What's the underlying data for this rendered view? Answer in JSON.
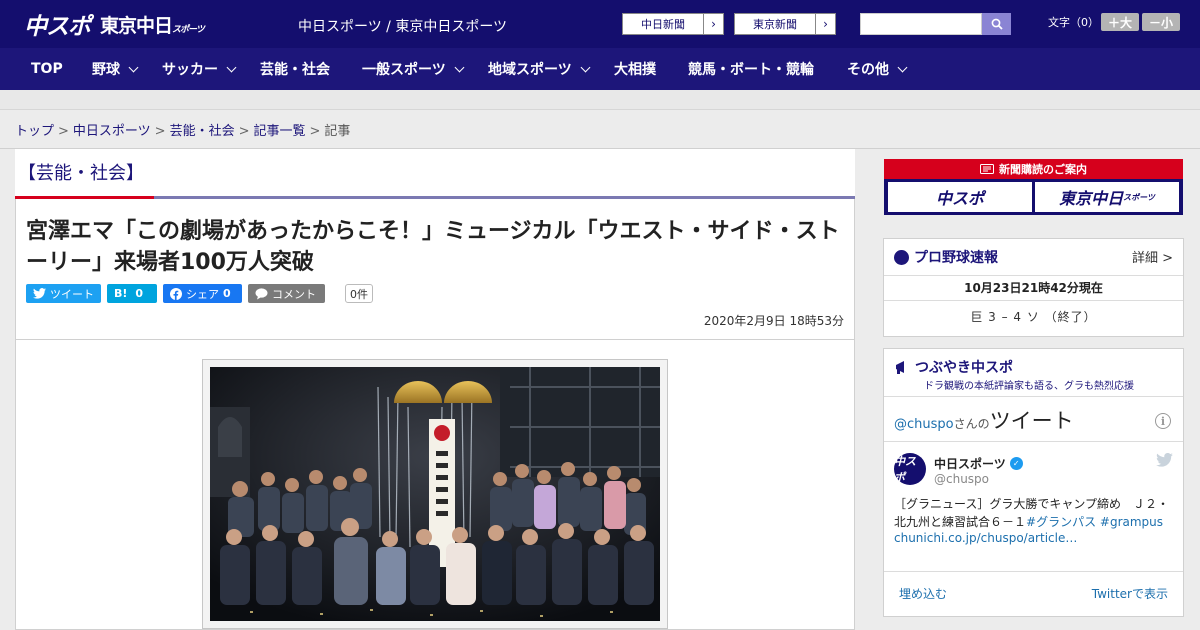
{
  "header": {
    "logo_chuspo": "中スポ",
    "logo_tokyo": "東京中日",
    "logo_tokyo_small": "スポーツ",
    "site_names": "中日スポーツ / 東京中日スポーツ",
    "ext_links": [
      "中日新聞",
      "東京新聞"
    ],
    "font_label": "文字（0）",
    "font_larger": "＋大",
    "font_smaller": "－小"
  },
  "nav": [
    {
      "label": "TOP",
      "dropdown": false
    },
    {
      "label": "野球",
      "dropdown": true
    },
    {
      "label": "サッカー",
      "dropdown": true
    },
    {
      "label": "芸能・社会",
      "dropdown": false
    },
    {
      "label": "一般スポーツ",
      "dropdown": true
    },
    {
      "label": "地域スポーツ",
      "dropdown": true
    },
    {
      "label": "大相撲",
      "dropdown": false
    },
    {
      "label": "競馬・ボート・競輪",
      "dropdown": false
    },
    {
      "label": "その他",
      "dropdown": true
    }
  ],
  "breadcrumb": {
    "items": [
      "トップ",
      "中日スポーツ",
      "芸能・社会",
      "記事一覧"
    ],
    "current": "記事",
    "separator": ">"
  },
  "article": {
    "category": "【芸能・社会】",
    "headline": "宮澤エマ「この劇場があったからこそ！」ミュージカル「ウエスト・サイド・ストーリー」来場者100万人突破",
    "share": {
      "tweet": "ツイート",
      "hatena": "B!",
      "hatena_count": "0",
      "facebook": "シェア",
      "facebook_count": "0",
      "comment": "コメント",
      "comment_count": "0件"
    },
    "date": "2020年2月9日 18時53分",
    "photo_banner": "来場者100万人"
  },
  "sidebar": {
    "subscription": {
      "title": "新聞購読のご案内",
      "btn1": "中スポ",
      "btn2": "東京中日",
      "btn2_small": "スポーツ"
    },
    "baseball": {
      "title": "プロ野球速報",
      "detail": "詳細 >",
      "status_time": "10月23日21時42分現在",
      "score": "巨 3 – 4 ソ （終了）"
    },
    "tweets": {
      "title": "つぶやき中スポ",
      "subtitle": "ドラ観戦の本紙評論家も語る、グラも熱烈応援",
      "handle": "@chuspo",
      "handle_suffix": "さんの",
      "handle_label": "ツイート",
      "info": "i",
      "avatar": "中スポ",
      "name": "中日スポーツ",
      "username": "@chuspo",
      "text": "［グラニュース］グラ大勝でキャンプ締め　Ｊ２・北九州と練習試合６－１",
      "hashtag1": "#グランパス",
      "hashtag2": "#grampus",
      "link": "chunichi.co.jp/chuspo/article…",
      "embed": "埋め込む",
      "view_on": "Twitterで表示"
    }
  },
  "colors": {
    "brand_navy": "#140e6e",
    "nav_navy": "#1d167a",
    "accent_red": "#d6001c",
    "twitter_blue": "#1da1f2",
    "hatena_blue": "#00a4de",
    "facebook_blue": "#1877f2",
    "comment_gray": "#7a7a7a"
  }
}
